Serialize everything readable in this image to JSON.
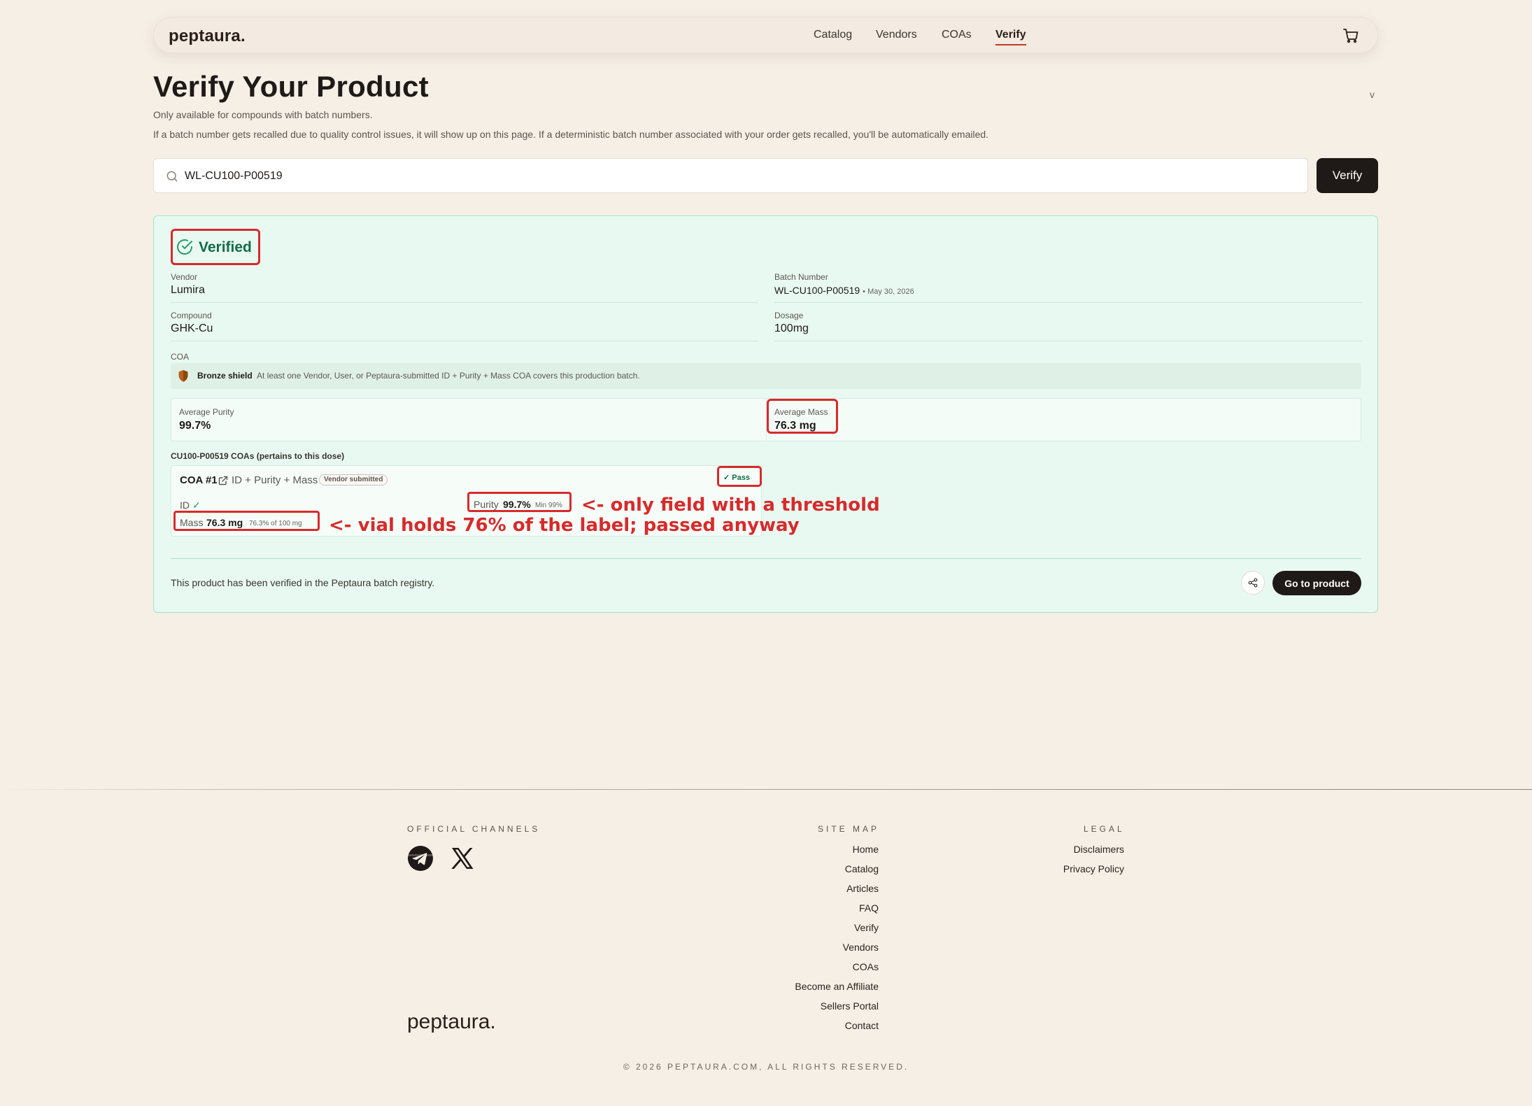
{
  "nav": {
    "brand": "peptaura.",
    "links": [
      "Catalog",
      "Vendors",
      "COAs",
      "Verify"
    ],
    "active": "Verify"
  },
  "header": {
    "title": "Verify Your Product",
    "v_mark": "v",
    "subtitle": "Only available for compounds with batch numbers.",
    "note": "If a batch number gets recalled due to quality control issues, it will show up on this page. If a deterministic batch number associated with your order gets recalled, you'll be automatically emailed."
  },
  "search": {
    "value": "WL-CU100-P00519",
    "button_label": "Verify"
  },
  "result": {
    "status": "Verified",
    "vendor_label": "Vendor",
    "vendor": "Lumira",
    "batch_label": "Batch Number",
    "batch": "WL-CU100-P00519",
    "batch_date": "• May 30, 2026",
    "compound_label": "Compound",
    "compound": "GHK-Cu",
    "dosage_label": "Dosage",
    "dosage": "100mg",
    "coa_label": "COA",
    "shield_name": "Bronze shield",
    "shield_desc": "At least one Vendor, User, or Peptaura-submitted ID + Purity + Mass COA covers this production batch.",
    "avg_purity_label": "Average Purity",
    "avg_purity": "99.7%",
    "avg_mass_label": "Average Mass",
    "avg_mass": "76.3 mg",
    "coa_section_title": "CU100-P00519 COAs (pertains to this dose)",
    "coa": {
      "name": "COA #1",
      "type": "ID + Purity + Mass",
      "tag": "Vendor submitted",
      "status": "Pass",
      "id_label": "ID",
      "purity_label": "Purity",
      "purity_value": "99.7%",
      "purity_note": "Min 99%",
      "mass_label": "Mass",
      "mass_value": "76.3 mg",
      "mass_note": "76.3% of 100 mg"
    },
    "annotations": {
      "purity": "<- only field with a threshold",
      "mass": "<- vial holds 76% of the label; passed anyway"
    },
    "registry_note": "This product has been verified in the Peptaura batch registry.",
    "go_button": "Go to product"
  },
  "footer": {
    "channels_heading": "OFFICIAL CHANNELS",
    "sitemap_heading": "SITE MAP",
    "legal_heading": "LEGAL",
    "sitemap_links": [
      "Home",
      "Catalog",
      "Articles",
      "FAQ",
      "Verify",
      "Vendors",
      "COAs",
      "Become an Affiliate",
      "Sellers Portal",
      "Contact"
    ],
    "legal_links": [
      "Disclaimers",
      "Privacy Policy"
    ],
    "brand": "peptaura.",
    "copyright": "© 2026 PEPTAURA.COM, ALL RIGHTS RESERVED."
  },
  "colors": {
    "accent_red": "#d62b2b",
    "verified_green": "#136b4c",
    "card_bg": "#e8f9f1",
    "page_bg": "#f6efe6",
    "button_dark": "#1f1a17"
  },
  "icons": [
    "cart-icon",
    "search-icon",
    "check-circle-icon",
    "shield-icon",
    "external-link-icon",
    "check-icon",
    "share-icon",
    "telegram-icon",
    "x-icon"
  ]
}
